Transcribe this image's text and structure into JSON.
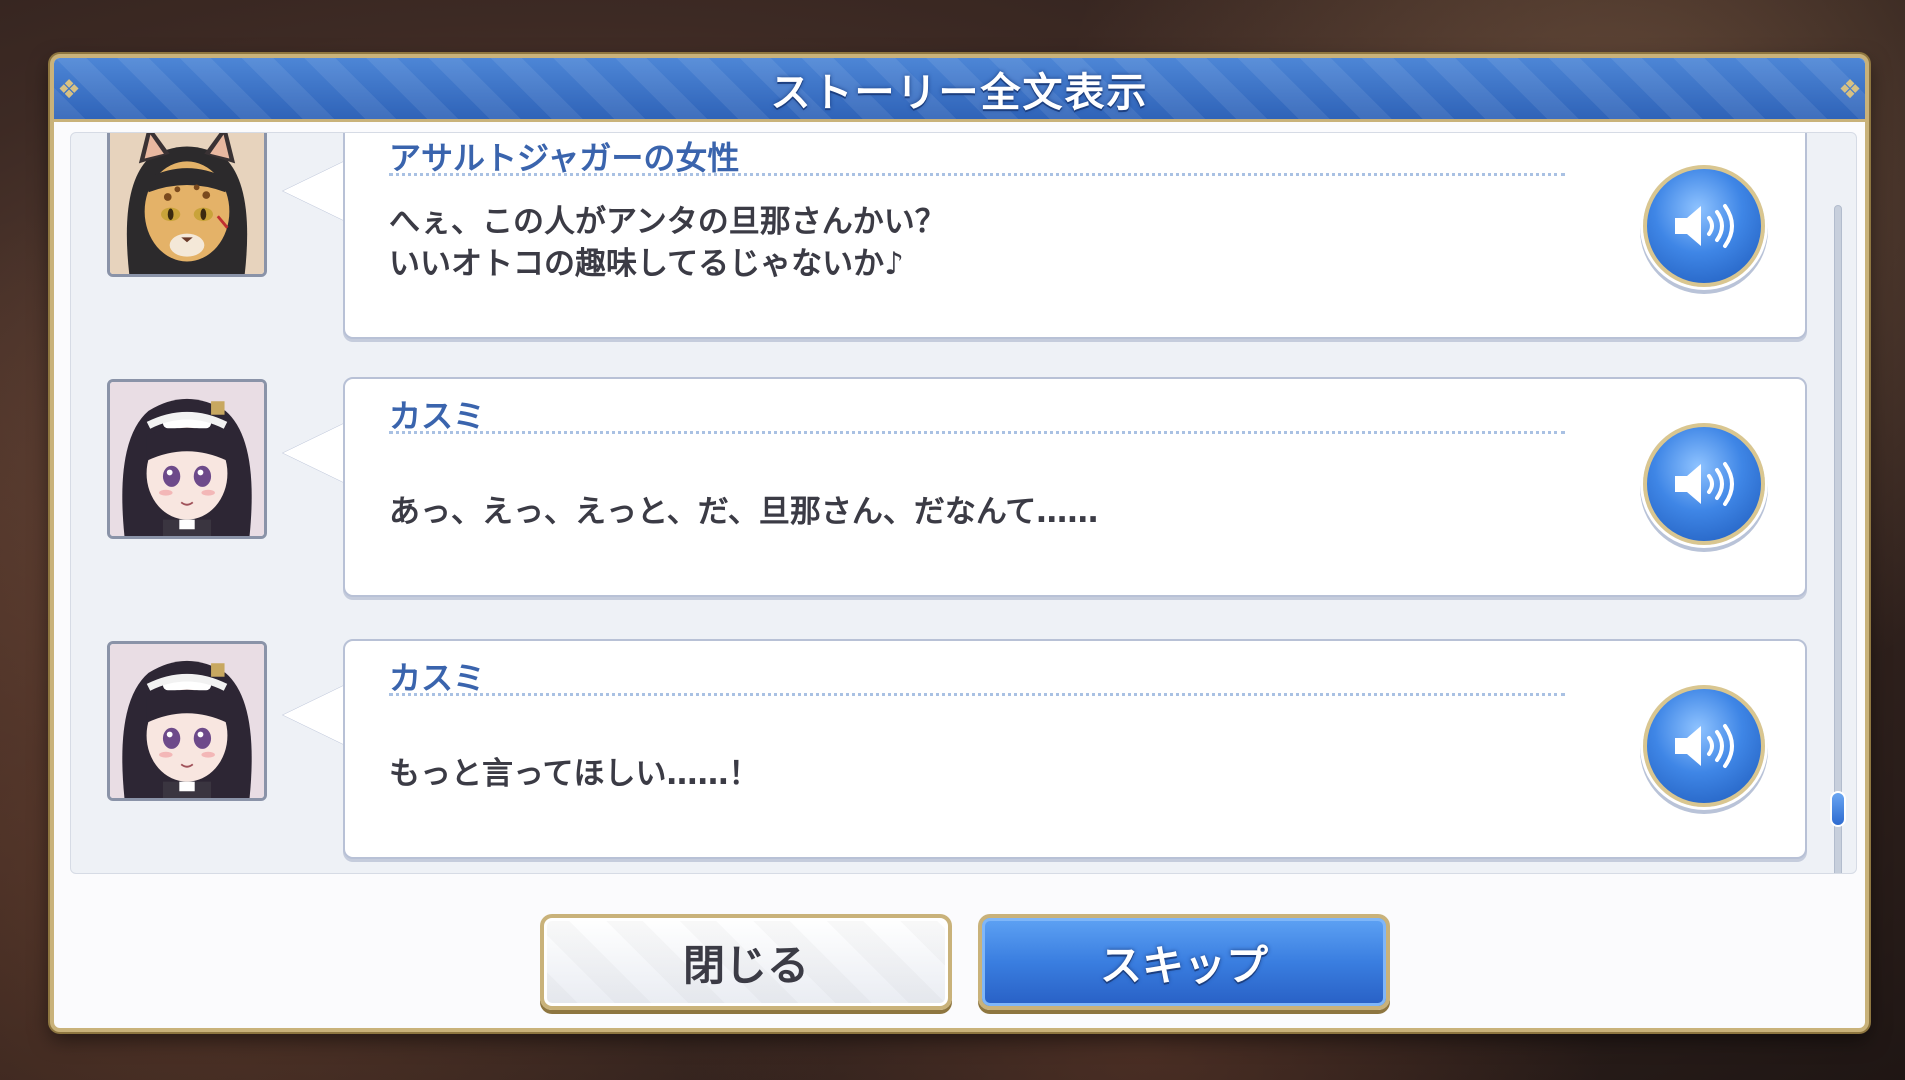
{
  "dialog": {
    "title": "ストーリー全文表示"
  },
  "entries": [
    {
      "speaker": "アサルトジャガーの女性",
      "lines": [
        "へぇ、この人がアンタの旦那さんかい？",
        "いいオトコの趣味してるじゃないか♪"
      ],
      "portrait": "jaguar-woman-portrait"
    },
    {
      "speaker": "カスミ",
      "lines": [
        "あっ、えっ、えっと、だ、旦那さん、だなんて……"
      ],
      "portrait": "kasumi-portrait"
    },
    {
      "speaker": "カスミ",
      "lines": [
        "もっと言ってほしい……！"
      ],
      "portrait": "kasumi-portrait"
    }
  ],
  "buttons": {
    "close_label": "閉じる",
    "skip_label": "スキップ"
  },
  "icons": {
    "voice": "speaker-icon"
  },
  "colors": {
    "header_blue": "#3a70c6",
    "gold_border": "#c9b27a",
    "speaker_name": "#3a64ad",
    "body_text": "#3b3b45"
  }
}
